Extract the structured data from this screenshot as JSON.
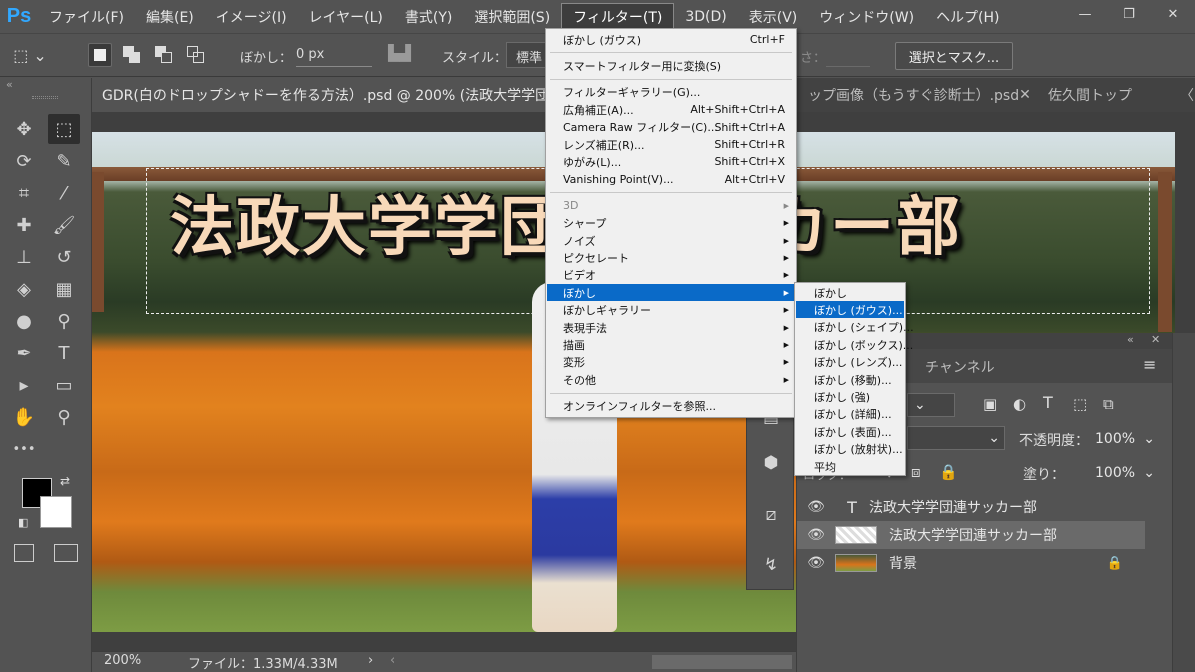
{
  "app": {
    "logo": "Ps"
  },
  "menubar": {
    "items": [
      "ファイル(F)",
      "編集(E)",
      "イメージ(I)",
      "レイヤー(L)",
      "書式(Y)",
      "選択範囲(S)",
      "フィルター(T)",
      "3D(D)",
      "表示(V)",
      "ウィンドウ(W)",
      "ヘルプ(H)"
    ],
    "active": "フィルター(T)",
    "window_controls": {
      "minimize": "—",
      "restore": "❐",
      "close": "✕"
    }
  },
  "options_bar": {
    "feather_label": "ぼかし：",
    "feather_value": "0 px",
    "style_label": "スタイル：",
    "style_value": "標準",
    "width_label": "さ：",
    "select_mask_button": "選択とマスク..."
  },
  "tabs": [
    {
      "label": "GDR(白のドロップシャドーを作る方法）.psd @ 200% (法政大学学団",
      "active": true
    },
    {
      "label": "ップ画像（もうすぐ診断士）.psd",
      "active": false,
      "close": "✕"
    },
    {
      "label": "佐久間トップ",
      "active": false
    },
    {
      "label": "〈",
      "active": false
    }
  ],
  "toolbar": {
    "collapse": "«",
    "tools": [
      {
        "name": "move-tool",
        "glyph": "✥"
      },
      {
        "name": "marquee-tool",
        "glyph": "⬚"
      },
      {
        "name": "lasso-tool",
        "glyph": "⟳"
      },
      {
        "name": "quick-select-tool",
        "glyph": "✎"
      },
      {
        "name": "crop-tool",
        "glyph": "⌗"
      },
      {
        "name": "eyedropper-tool",
        "glyph": "⁄"
      },
      {
        "name": "healing-tool",
        "glyph": "✚"
      },
      {
        "name": "brush-tool",
        "glyph": "🖌"
      },
      {
        "name": "stamp-tool",
        "glyph": "⊥"
      },
      {
        "name": "history-brush-tool",
        "glyph": "↺"
      },
      {
        "name": "eraser-tool",
        "glyph": "◈"
      },
      {
        "name": "gradient-tool",
        "glyph": "▦"
      },
      {
        "name": "blur-tool",
        "glyph": "●"
      },
      {
        "name": "dodge-tool",
        "glyph": "⚲"
      },
      {
        "name": "pen-tool",
        "glyph": "✒"
      },
      {
        "name": "type-tool",
        "glyph": "T"
      },
      {
        "name": "path-select-tool",
        "glyph": "▸"
      },
      {
        "name": "shape-tool",
        "glyph": "▭"
      },
      {
        "name": "hand-tool",
        "glyph": "✋"
      },
      {
        "name": "zoom-tool",
        "glyph": "⚲"
      },
      {
        "name": "more-tools",
        "glyph": "•••"
      }
    ]
  },
  "canvas": {
    "title_text": "法政大学学団連サッカー部"
  },
  "status": {
    "zoom": "200%",
    "file_info": "ファイル：1.33M/4.33M",
    "arrow": "›",
    "scroll_left": "‹"
  },
  "filter_menu": {
    "items": [
      {
        "label": "ぼかし (ガウス)",
        "shortcut": "Ctrl+F"
      },
      {
        "sep": true
      },
      {
        "label": "スマートフィルター用に変換(S)"
      },
      {
        "sep": true
      },
      {
        "label": "フィルターギャラリー(G)..."
      },
      {
        "label": "広角補正(A)...",
        "shortcut": "Alt+Shift+Ctrl+A"
      },
      {
        "label": "Camera Raw フィルター(C)...",
        "shortcut": "Shift+Ctrl+A"
      },
      {
        "label": "レンズ補正(R)...",
        "shortcut": "Shift+Ctrl+R"
      },
      {
        "label": "ゆがみ(L)...",
        "shortcut": "Shift+Ctrl+X"
      },
      {
        "label": "Vanishing Point(V)...",
        "shortcut": "Alt+Ctrl+V"
      },
      {
        "sep": true
      },
      {
        "label": "3D",
        "sub": true,
        "disabled": true
      },
      {
        "label": "シャープ",
        "sub": true
      },
      {
        "label": "ノイズ",
        "sub": true
      },
      {
        "label": "ピクセレート",
        "sub": true
      },
      {
        "label": "ビデオ",
        "sub": true
      },
      {
        "label": "ぼかし",
        "sub": true,
        "highlight": true
      },
      {
        "label": "ぼかしギャラリー",
        "sub": true
      },
      {
        "label": "表現手法",
        "sub": true
      },
      {
        "label": "描画",
        "sub": true
      },
      {
        "label": "変形",
        "sub": true
      },
      {
        "label": "その他",
        "sub": true
      },
      {
        "sep": true
      },
      {
        "label": "オンラインフィルターを参照..."
      }
    ],
    "submenu_arrow": "▶"
  },
  "blur_submenu": {
    "items": [
      {
        "label": "ぼかし"
      },
      {
        "label": "ぼかし (ガウス)...",
        "highlight": true
      },
      {
        "label": "ぼかし (シェイプ)..."
      },
      {
        "label": "ぼかし (ボックス)..."
      },
      {
        "label": "ぼかし (レンズ)..."
      },
      {
        "label": "ぼかし (移動)..."
      },
      {
        "label": "ぼかし (強)"
      },
      {
        "label": "ぼかし (詳細)..."
      },
      {
        "label": "ぼかし (表面)..."
      },
      {
        "label": "ぼかし (放射状)..."
      },
      {
        "label": "平均"
      }
    ]
  },
  "layers_panel": {
    "collapse": "«",
    "close": "✕",
    "tab_channel": "チャンネル",
    "menu": "≡",
    "opacity_label": "不透明度：",
    "opacity_value": "100%",
    "fill_label": "塗り：",
    "fill_value": "100%",
    "lock_label": "ロック：",
    "layers": [
      {
        "name": "法政大学学団連サッカー部",
        "kind": "text",
        "type_icon": "T",
        "selected": false
      },
      {
        "name": "法政大学学団連サッカー部",
        "kind": "raster",
        "selected": true
      },
      {
        "name": "背景",
        "kind": "background",
        "selected": false,
        "locked": true
      }
    ]
  }
}
